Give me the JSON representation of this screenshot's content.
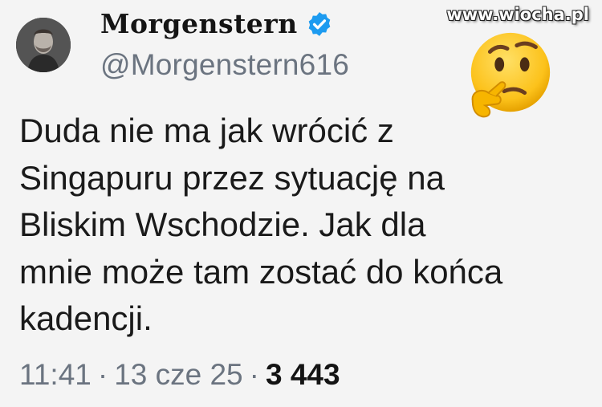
{
  "author": {
    "display_name": "Morgenstern",
    "handle": "@Morgenstern616",
    "verified": true,
    "verified_badge_color": "#1d9bf0",
    "avatar_icon": "profile-photo"
  },
  "watermark": "www.wiocha.pl",
  "reaction_emoji": "thinking-face",
  "tweet": {
    "lines": [
      "Duda nie ma jak wrócić z",
      "Singapuru przez sytuację na",
      "Bliskim Wschodzie. Jak dla",
      "mnie może tam zostać do końca",
      "kadencji."
    ]
  },
  "meta": {
    "time": "11:41",
    "separator": "·",
    "date": "13 cze 25",
    "views": "3 443"
  }
}
